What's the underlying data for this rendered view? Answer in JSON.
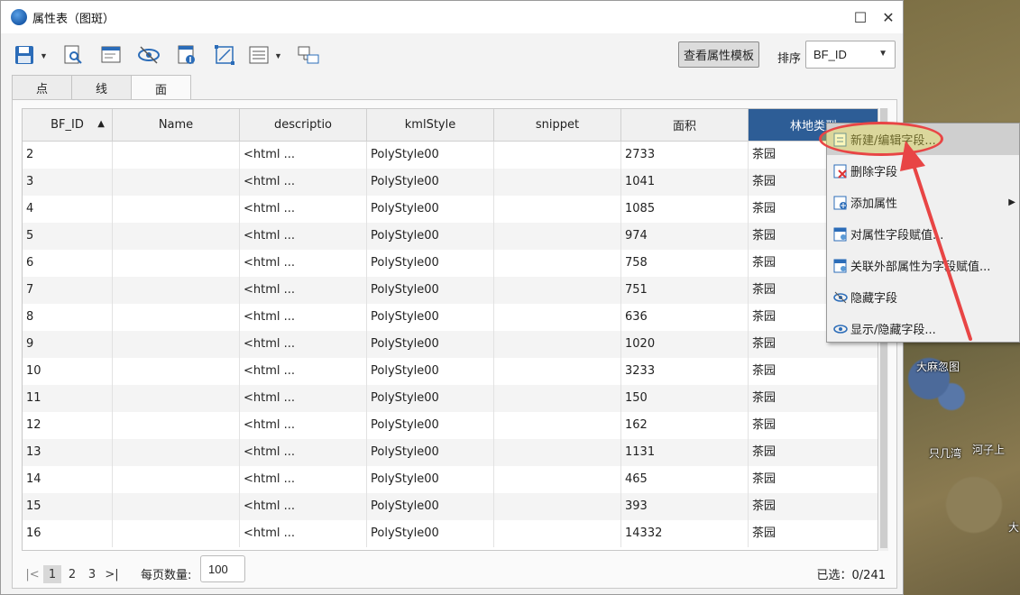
{
  "window": {
    "title": "属性表（图斑）",
    "minimize_glyph": "☐",
    "close_glyph": "✕"
  },
  "toolbar": {
    "template_button": "查看属性模板",
    "sort_label": "排序",
    "sort_value": "BF_ID",
    "icons": [
      "save-icon",
      "preview-icon",
      "edit-table-icon",
      "eye-icon",
      "export-icon",
      "select-icon",
      "list-icon",
      "link-windows-icon"
    ]
  },
  "tabs": [
    {
      "label": "点",
      "active": false
    },
    {
      "label": "线",
      "active": false
    },
    {
      "label": "面",
      "active": true
    }
  ],
  "table": {
    "columns": [
      "BF_ID",
      "Name",
      "descriptio",
      "kmlStyle",
      "snippet",
      "面积",
      "林地类型"
    ],
    "rows": [
      [
        "2",
        "",
        "<html ...",
        "PolyStyle00",
        "",
        "2733",
        "茶园"
      ],
      [
        "3",
        "",
        "<html ...",
        "PolyStyle00",
        "",
        "1041",
        "茶园"
      ],
      [
        "4",
        "",
        "<html ...",
        "PolyStyle00",
        "",
        "1085",
        "茶园"
      ],
      [
        "5",
        "",
        "<html ...",
        "PolyStyle00",
        "",
        "974",
        "茶园"
      ],
      [
        "6",
        "",
        "<html ...",
        "PolyStyle00",
        "",
        "758",
        "茶园"
      ],
      [
        "7",
        "",
        "<html ...",
        "PolyStyle00",
        "",
        "751",
        "茶园"
      ],
      [
        "8",
        "",
        "<html ...",
        "PolyStyle00",
        "",
        "636",
        "茶园"
      ],
      [
        "9",
        "",
        "<html ...",
        "PolyStyle00",
        "",
        "1020",
        "茶园"
      ],
      [
        "10",
        "",
        "<html ...",
        "PolyStyle00",
        "",
        "3233",
        "茶园"
      ],
      [
        "11",
        "",
        "<html ...",
        "PolyStyle00",
        "",
        "150",
        "茶园"
      ],
      [
        "12",
        "",
        "<html ...",
        "PolyStyle00",
        "",
        "162",
        "茶园"
      ],
      [
        "13",
        "",
        "<html ...",
        "PolyStyle00",
        "",
        "1131",
        "茶园"
      ],
      [
        "14",
        "",
        "<html ...",
        "PolyStyle00",
        "",
        "465",
        "茶园"
      ],
      [
        "15",
        "",
        "<html ...",
        "PolyStyle00",
        "",
        "393",
        "茶园"
      ],
      [
        "16",
        "",
        "<html ...",
        "PolyStyle00",
        "",
        "14332",
        "茶园"
      ]
    ]
  },
  "pager": {
    "pages": [
      "1",
      "2",
      "3"
    ],
    "current": "1",
    "per_page_label": "每页数量:",
    "per_page_value": "100",
    "selected": "已选：0/241"
  },
  "context_menu": {
    "items": [
      {
        "label": "新建/编辑字段...",
        "icon": "new-field-icon",
        "hover": true
      },
      {
        "label": "删除字段",
        "icon": "delete-field-icon"
      },
      {
        "label": "添加属性",
        "icon": "add-attribute-icon",
        "submenu": true
      },
      {
        "label": "对属性字段赋值...",
        "icon": "assign-value-icon"
      },
      {
        "label": "关联外部属性为字段赋值...",
        "icon": "link-external-icon"
      },
      {
        "label": "隐藏字段",
        "icon": "hide-field-icon"
      },
      {
        "label": "显示/隐藏字段...",
        "icon": "toggle-field-icon"
      }
    ]
  },
  "map_labels": [
    "大麻忽图",
    "只几湾",
    "河子上",
    "大"
  ],
  "colors": {
    "selected_header": "#2d5d96",
    "annotation": "#e84545"
  }
}
